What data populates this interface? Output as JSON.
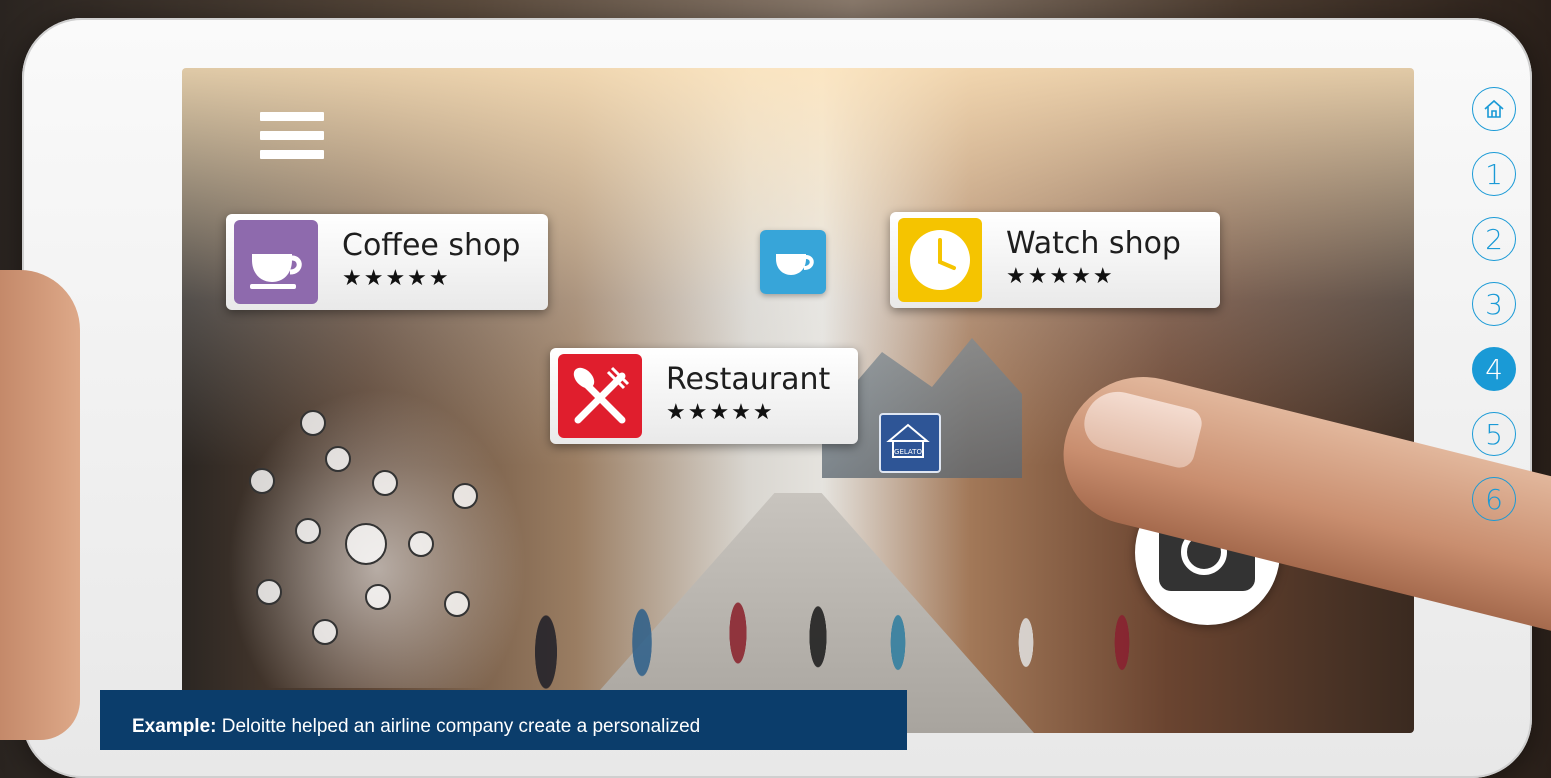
{
  "cards": [
    {
      "title": "Coffee shop",
      "stars": "★★★★★",
      "icon": "coffee-cup-icon",
      "color": "#8e6aad"
    },
    {
      "title": "Restaurant",
      "stars": "★★★★★",
      "icon": "fork-knife-icon",
      "color": "#e01e2d"
    },
    {
      "title": "Watch shop",
      "stars": "★★★★★",
      "icon": "clock-icon",
      "color": "#f5c400"
    }
  ],
  "map_icons": {
    "coffee": "coffee-cup-icon",
    "gelato": "gelato-shop-icon",
    "gelato_label": "GELATO"
  },
  "steps": {
    "home_icon": "home-icon",
    "items": [
      "1",
      "2",
      "3",
      "4",
      "5",
      "6"
    ],
    "active": "4",
    "color": "#1a9ad6"
  },
  "caption": {
    "lead": "Example:",
    "text": "Deloitte helped an airline company create a personalized"
  }
}
